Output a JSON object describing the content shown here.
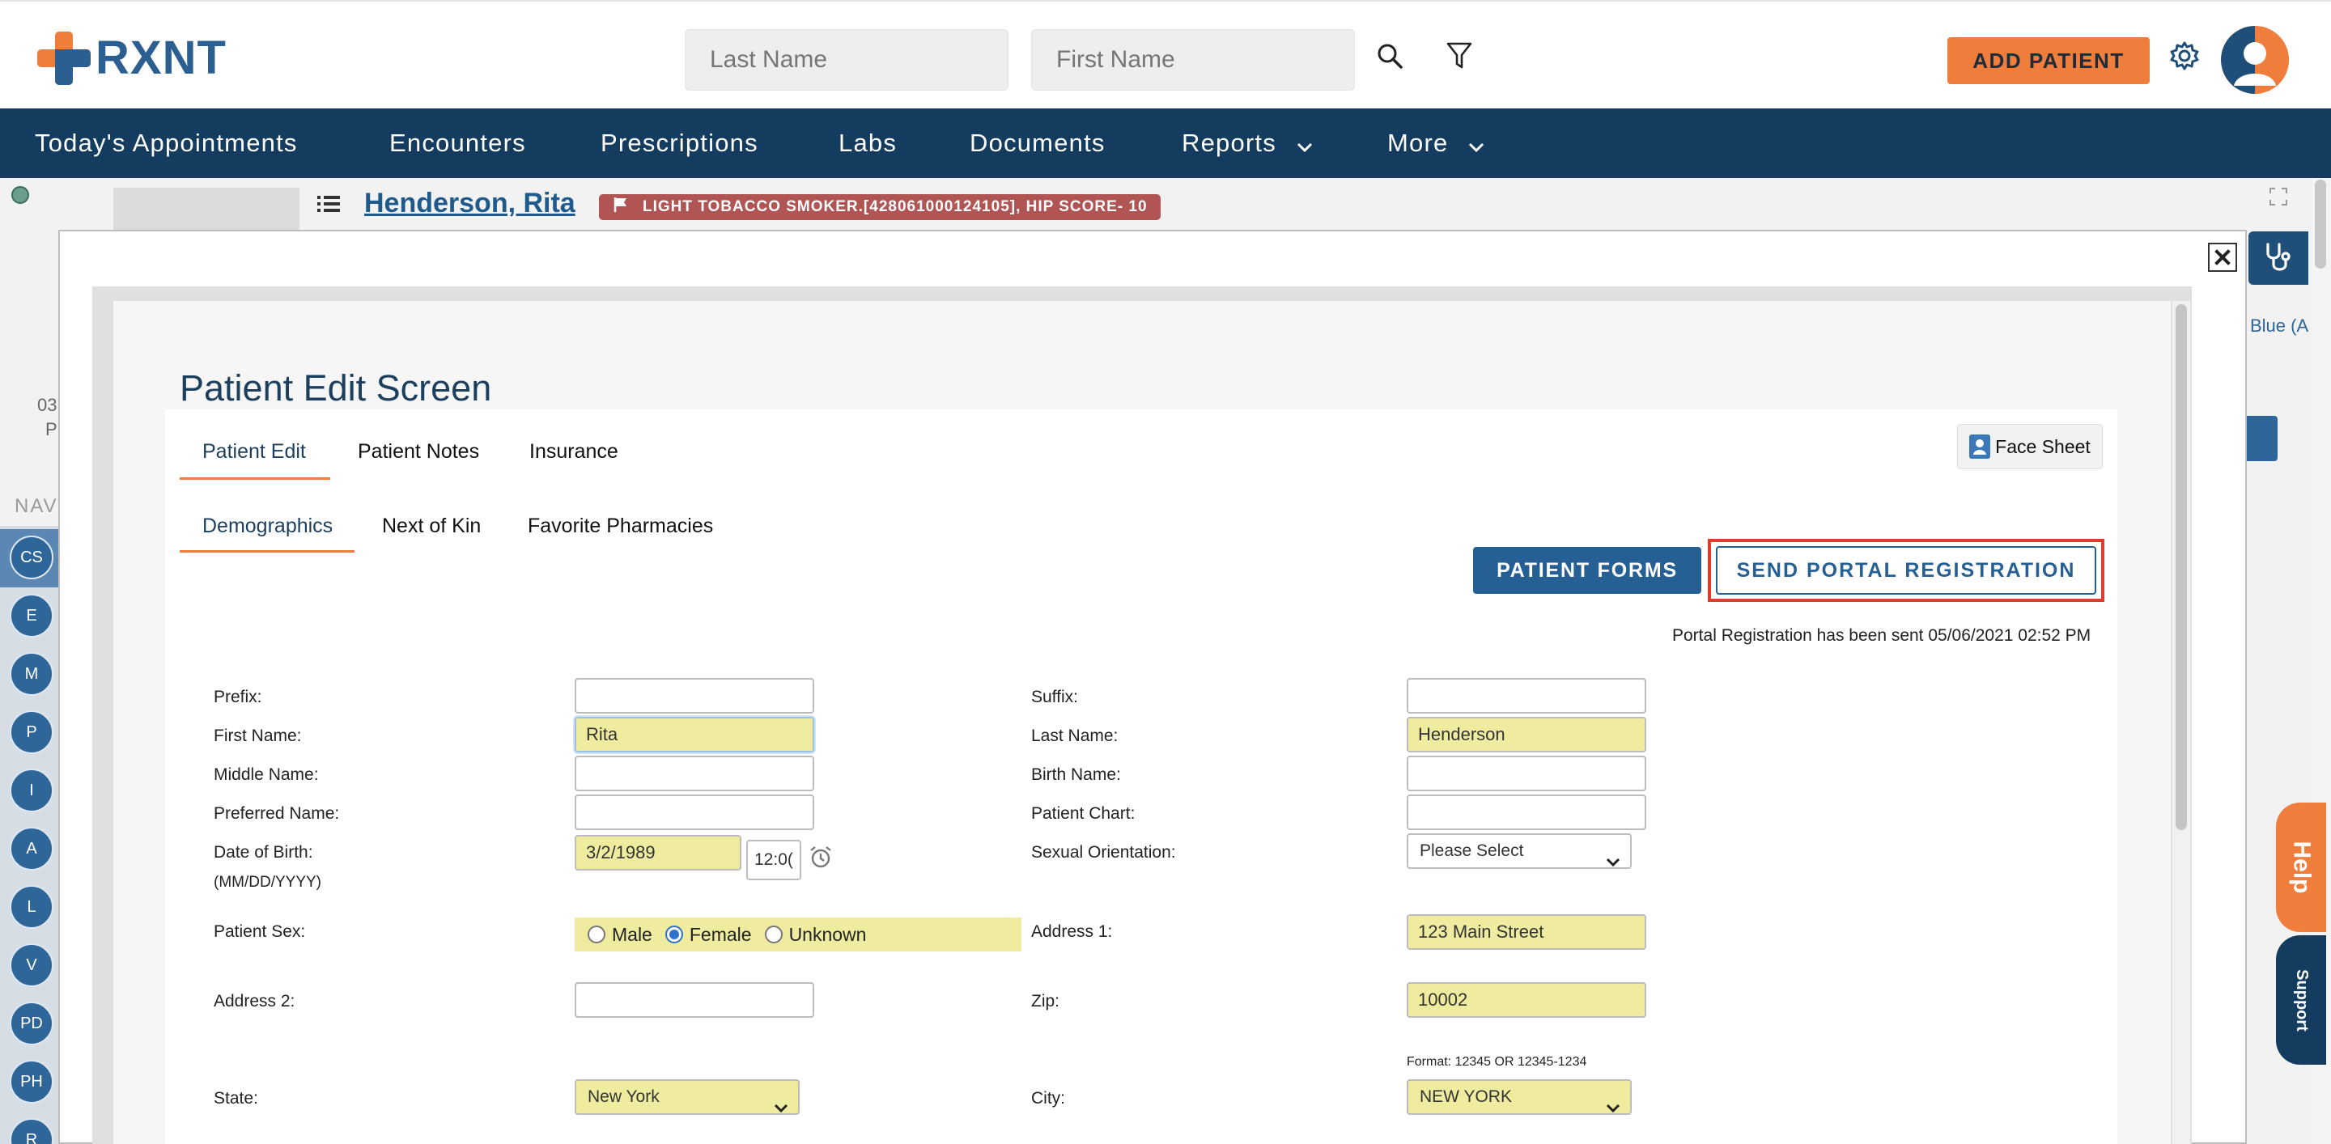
{
  "header": {
    "logo_text": "RXNT",
    "search_last_placeholder": "Last Name",
    "search_first_placeholder": "First Name",
    "add_patient_label": "ADD PATIENT"
  },
  "nav": {
    "items": [
      {
        "label": "Today's Appointments"
      },
      {
        "label": "Encounters"
      },
      {
        "label": "Prescriptions"
      },
      {
        "label": "Labs"
      },
      {
        "label": "Documents"
      },
      {
        "label": "Reports"
      },
      {
        "label": "More"
      }
    ]
  },
  "patient": {
    "name": "Henderson, Rita",
    "alert": "LIGHT TOBACCO SMOKER.[428061000124105], HIP SCORE- 10",
    "left_text_1": "03",
    "left_text_2": "P",
    "right_text": "Blue (A"
  },
  "side_nav": {
    "label": "NAV",
    "items": [
      "CS",
      "E",
      "M",
      "P",
      "I",
      "A",
      "L",
      "V",
      "PD",
      "PH",
      "R"
    ]
  },
  "modal": {
    "title": "Patient Edit Screen",
    "tabs": [
      "Patient Edit",
      "Patient Notes",
      "Insurance"
    ],
    "subtabs": [
      "Demographics",
      "Next of Kin",
      "Favorite Pharmacies"
    ],
    "face_sheet_label": "Face Sheet",
    "patient_forms_label": "PATIENT FORMS",
    "send_portal_label": "SEND PORTAL REGISTRATION",
    "portal_status": "Portal Registration has been sent 05/06/2021 02:52 PM"
  },
  "form": {
    "prefix_label": "Prefix:",
    "prefix_value": "",
    "suffix_label": "Suffix:",
    "suffix_value": "",
    "first_name_label": "First Name:",
    "first_name_value": "Rita",
    "last_name_label": "Last Name:",
    "last_name_value": "Henderson",
    "middle_name_label": "Middle Name:",
    "middle_name_value": "",
    "birth_name_label": "Birth Name:",
    "birth_name_value": "",
    "preferred_name_label": "Preferred Name:",
    "preferred_name_value": "",
    "patient_chart_label": "Patient Chart:",
    "patient_chart_value": "",
    "dob_label": "Date of Birth:",
    "dob_hint": "(MM/DD/YYYY)",
    "dob_value": "3/2/1989",
    "time_value": "12:0(",
    "sexual_orientation_label": "Sexual Orientation:",
    "sexual_orientation_value": "Please Select",
    "patient_sex_label": "Patient Sex:",
    "sex_options": [
      "Male",
      "Female",
      "Unknown"
    ],
    "sex_selected": "Female",
    "address1_label": "Address 1:",
    "address1_value": "123 Main Street",
    "address2_label": "Address 2:",
    "address2_value": "",
    "zip_label": "Zip:",
    "zip_value": "10002",
    "zip_format_hint": "Format: 12345 OR 12345-1234",
    "state_label": "State:",
    "state_value": "New York",
    "city_label": "City:",
    "city_value": "NEW YORK"
  },
  "help": {
    "help_label": "Help",
    "support_label": "Support"
  },
  "colors": {
    "brand_orange": "#ef7d3c",
    "brand_blue": "#2b5f91",
    "nav_bg": "#143c5e",
    "required_yellow": "#f0ec9f",
    "highlight_red": "#e23b2e"
  }
}
